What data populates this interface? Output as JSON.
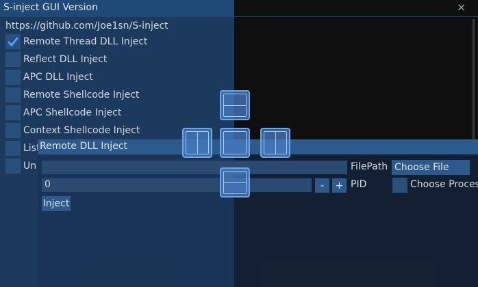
{
  "window": {
    "title": "S-inject GUI Version",
    "close_icon": "×",
    "url": "https://github.com/Joe1sn/S-inject"
  },
  "options": [
    {
      "label": "Remote Thread DLL Inject",
      "checked": true
    },
    {
      "label": "Reflect DLL Inject",
      "checked": false
    },
    {
      "label": "APC DLL Inject",
      "checked": false
    },
    {
      "label": "Remote Shellcode Inject",
      "checked": false
    },
    {
      "label": "APC Shellcode Inject",
      "checked": false
    },
    {
      "label": "Context Shellcode Inject",
      "checked": false
    },
    {
      "label": "List",
      "checked": false
    },
    {
      "label": "Un",
      "checked": false
    }
  ],
  "child_window": {
    "title": "Remote DLL Inject",
    "filepath": {
      "value": "",
      "label": "FilePath",
      "choose_button": "Choose File"
    },
    "pid": {
      "value": "0",
      "minus": "-",
      "plus": "+",
      "label": "PID"
    },
    "choose_process": {
      "label": "Choose Process",
      "checked": false
    },
    "inject_button": "Inject"
  },
  "colors": {
    "accent": "#2d5a8c",
    "checkbox": "#2a4f7a",
    "check": "#4aa0ff"
  }
}
